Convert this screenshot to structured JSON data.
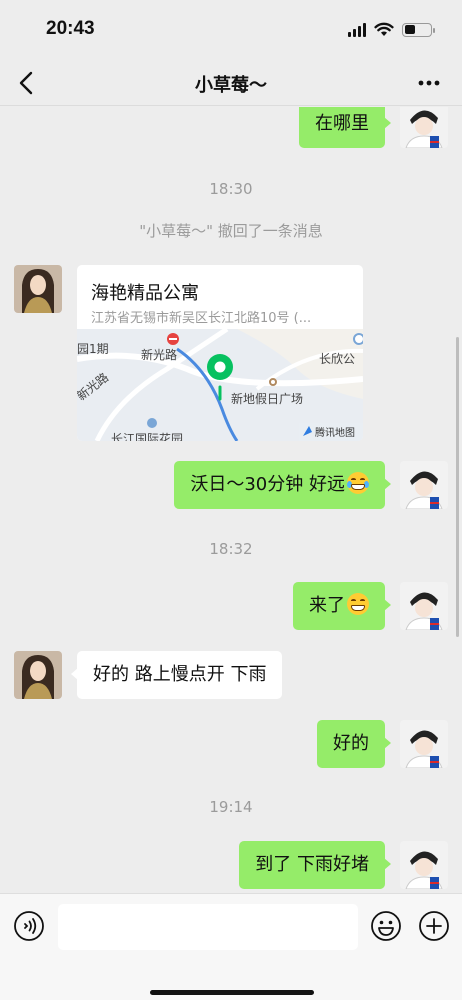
{
  "status_bar": {
    "time": "20:43",
    "battery_fraction": 0.4
  },
  "nav": {
    "title": "小草莓～"
  },
  "messages": {
    "m1": "在哪里",
    "t1": "18:30",
    "recall": "\"小草莓～\" 撤回了一条消息",
    "location": {
      "name": "海艳精品公寓",
      "address": "江苏省无锡市新吴区长江北路10号 (...",
      "map_labels": {
        "road1": "新光路",
        "road2": "新光路",
        "phase": "园1期",
        "place1": "长欣公",
        "place2": "新地假日广场",
        "place3": "长江国际花园",
        "provider": "腾讯地图"
      }
    },
    "m2": "沃日～30分钟 好远",
    "t2": "18:32",
    "m3": "来了",
    "m4": "好的 路上慢点开 下雨",
    "m5": "好的",
    "t3": "19:14",
    "m6": "到了 下雨好堵"
  },
  "icons": {
    "back": "chevron-left-icon",
    "more": "more-dots-icon",
    "voice": "voice-icon",
    "emoji": "emoji-icon",
    "plus": "plus-icon"
  },
  "colors": {
    "sent_bubble": "#95ec69",
    "background": "#ededed",
    "map_pin": "#07c160"
  }
}
